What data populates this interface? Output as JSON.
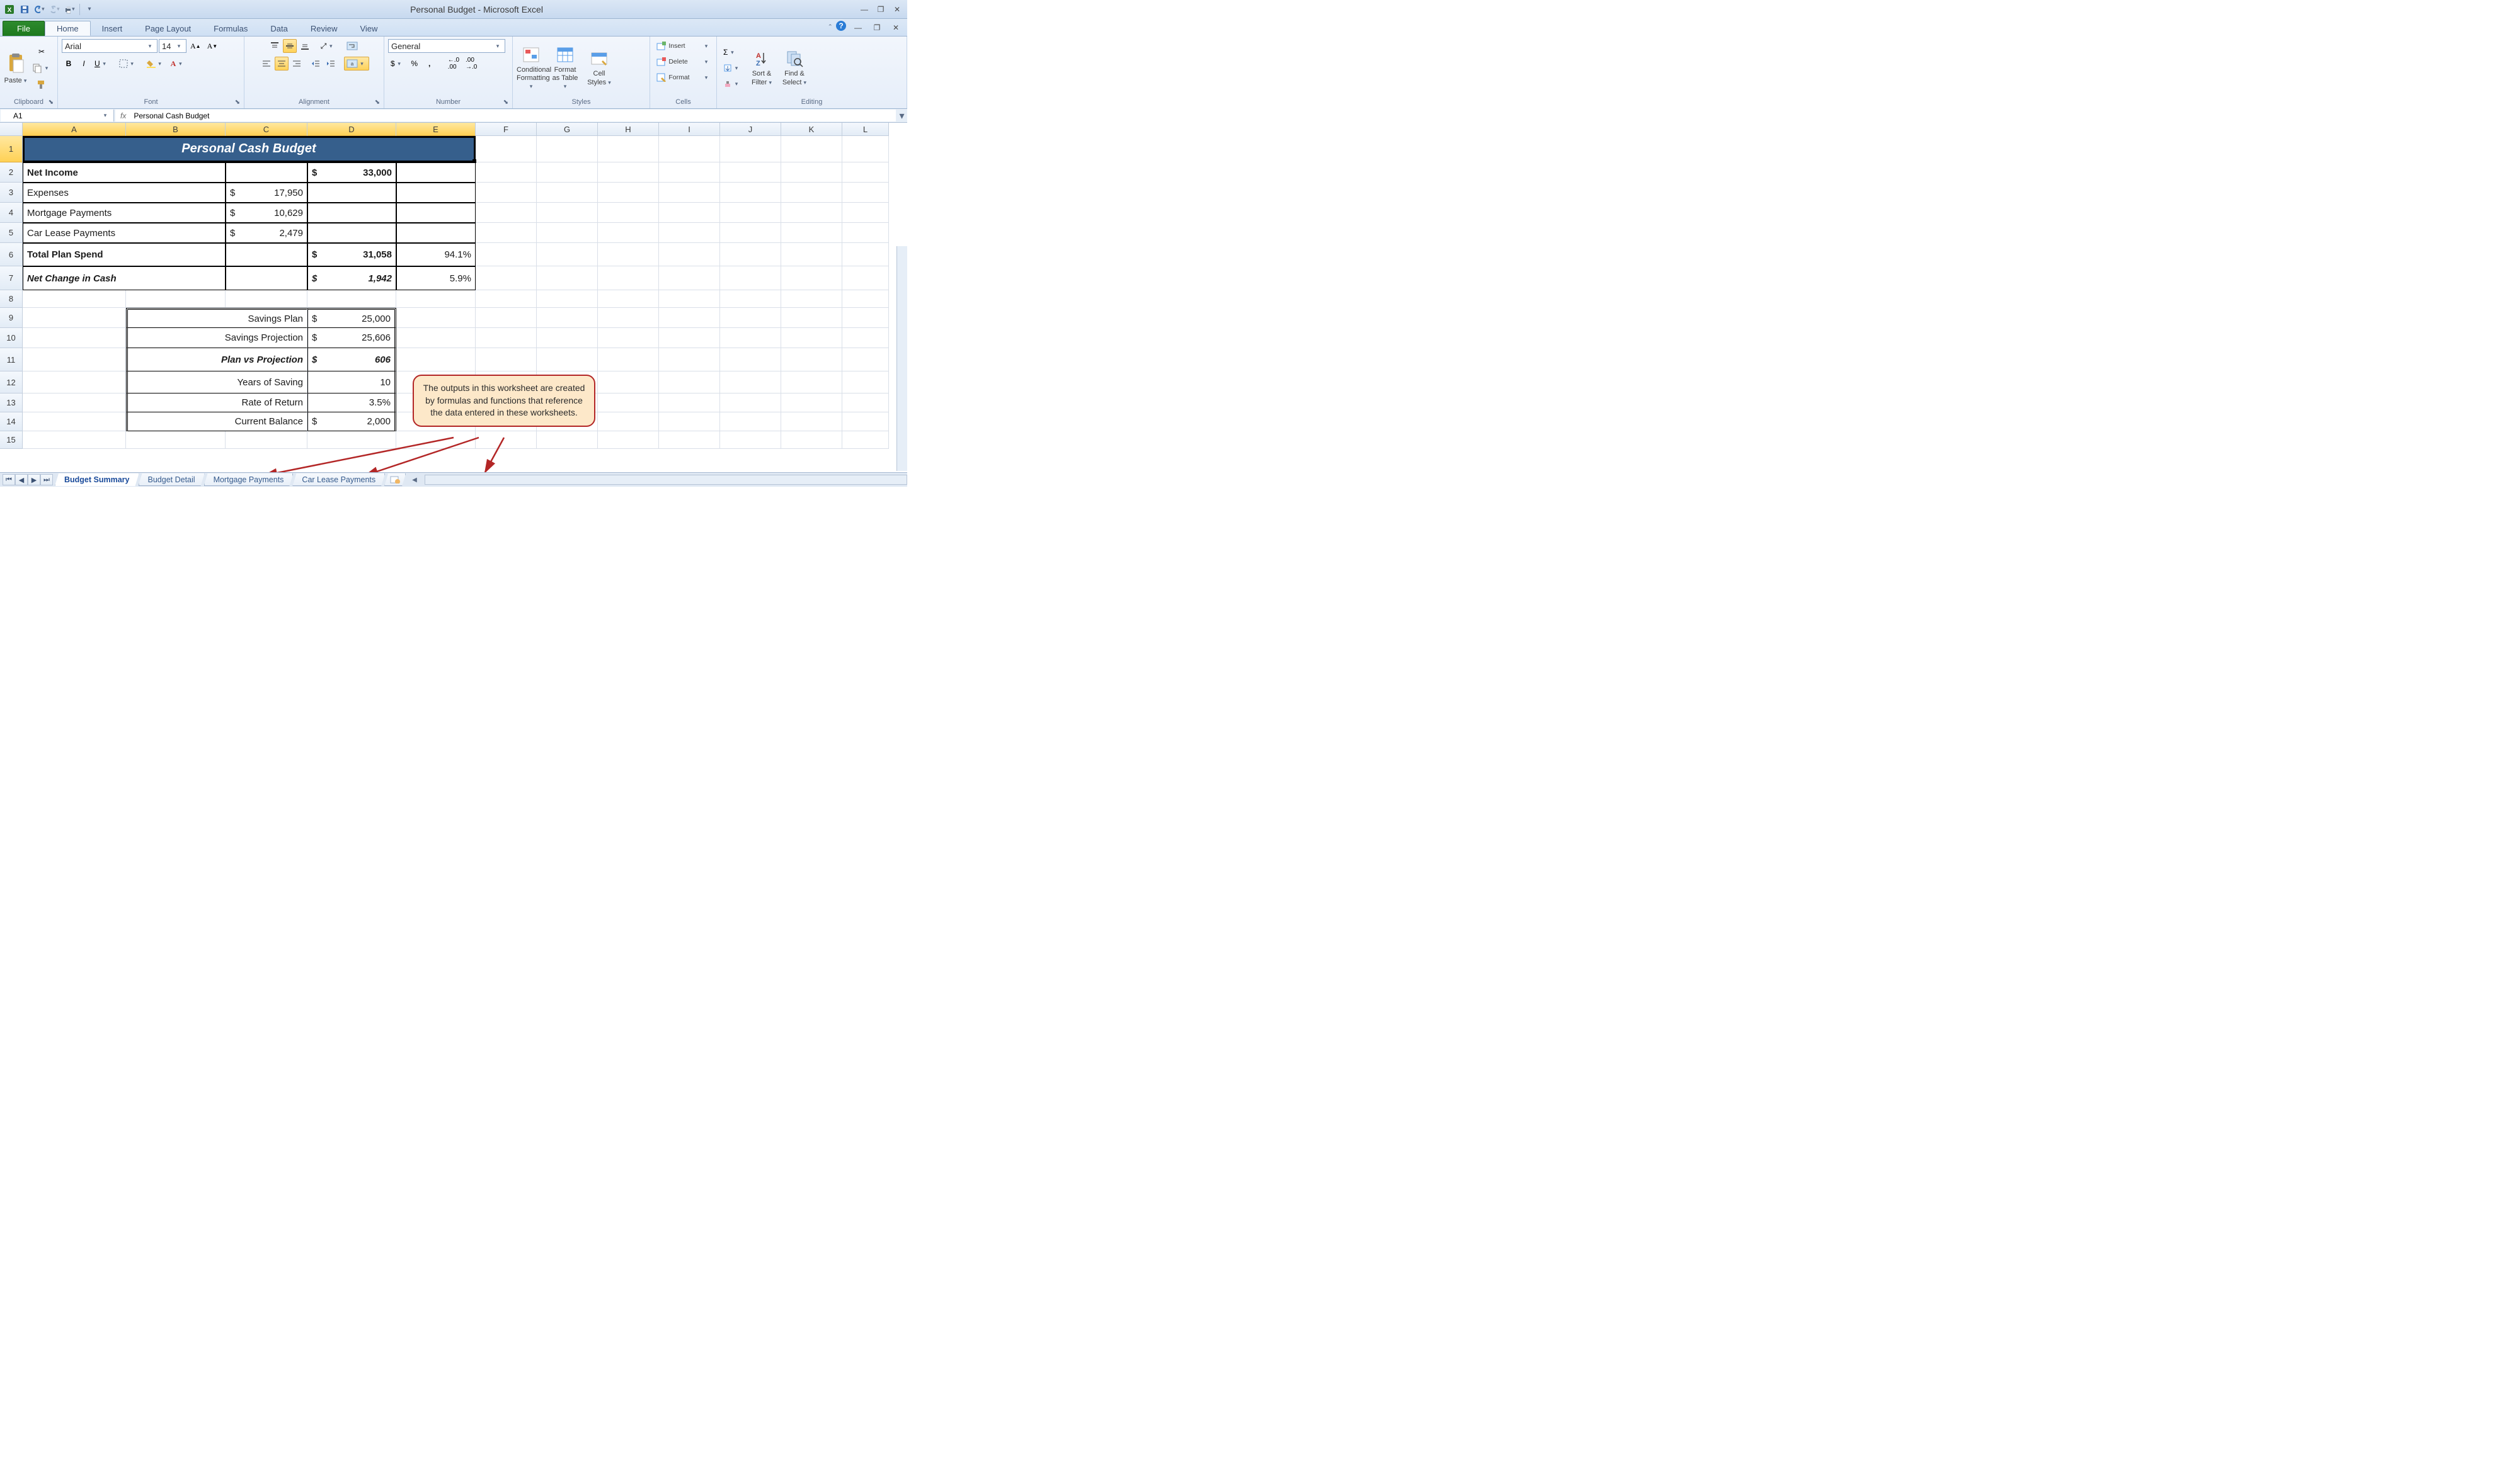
{
  "app_title": "Personal Budget - Microsoft Excel",
  "ribbon": {
    "file": "File",
    "tabs": [
      "Home",
      "Insert",
      "Page Layout",
      "Formulas",
      "Data",
      "Review",
      "View"
    ],
    "active_tab": "Home",
    "groups": {
      "clipboard": {
        "title": "Clipboard",
        "paste": "Paste"
      },
      "font": {
        "title": "Font",
        "name": "Arial",
        "size": "14"
      },
      "alignment": {
        "title": "Alignment"
      },
      "number": {
        "title": "Number",
        "format": "General"
      },
      "styles": {
        "title": "Styles",
        "cond": "Conditional Formatting",
        "fat": "Format as Table",
        "cell": "Cell Styles"
      },
      "cells": {
        "title": "Cells",
        "insert": "Insert",
        "delete": "Delete",
        "format": "Format"
      },
      "editing": {
        "title": "Editing",
        "sort": "Sort & Filter",
        "find": "Find & Select"
      }
    }
  },
  "name_box": "A1",
  "formula_bar": "Personal Cash Budget",
  "columns": [
    "A",
    "B",
    "C",
    "D",
    "E",
    "F",
    "G",
    "H",
    "I",
    "J",
    "K",
    "L"
  ],
  "col_widths": {
    "A": 164,
    "B": 158,
    "C": 130,
    "D": 141,
    "E": 126,
    "F": 97,
    "G": 97,
    "H": 97,
    "I": 97,
    "J": 97,
    "K": 97,
    "L": 74
  },
  "rows": [
    1,
    2,
    3,
    4,
    5,
    6,
    7,
    8,
    9,
    10,
    11,
    12,
    13,
    14,
    15
  ],
  "row_heights": {
    "1": 42,
    "2": 32,
    "3": 32,
    "4": 32,
    "5": 32,
    "6": 37,
    "7": 38,
    "8": 28,
    "9": 32,
    "10": 32,
    "11": 37,
    "12": 35,
    "13": 30,
    "14": 30,
    "15": 28
  },
  "budget": {
    "title": "Personal Cash Budget",
    "r2": {
      "label": "Net Income",
      "d_sym": "$",
      "d_val": "33,000"
    },
    "r3": {
      "label": "Expenses",
      "c_sym": "$",
      "c_val": "17,950"
    },
    "r4": {
      "label": "Mortgage Payments",
      "c_sym": "$",
      "c_val": "10,629"
    },
    "r5": {
      "label": "Car Lease Payments",
      "c_sym": "$",
      "c_val": "2,479"
    },
    "r6": {
      "label": "Total Plan Spend",
      "d_sym": "$",
      "d_val": "31,058",
      "e": "94.1%"
    },
    "r7": {
      "label": "Net Change in Cash",
      "d_sym": "$",
      "d_val": "1,942",
      "e": "5.9%"
    },
    "r9": {
      "label": "Savings Plan",
      "d_sym": "$",
      "d_val": "25,000"
    },
    "r10": {
      "label": "Savings Projection",
      "d_sym": "$",
      "d_val": "25,606"
    },
    "r11": {
      "label": "Plan vs Projection",
      "d_sym": "$",
      "d_val": "606"
    },
    "r12": {
      "label": "Years of Saving",
      "d_val": "10"
    },
    "r13": {
      "label": "Rate of Return",
      "d_val": "3.5%"
    },
    "r14": {
      "label": "Current Balance",
      "d_sym": "$",
      "d_val": "2,000"
    }
  },
  "callout": "The outputs in this worksheet are created by formulas and functions that reference the data entered in these worksheets.",
  "ws_tabs": [
    "Budget Summary",
    "Budget Detail",
    "Mortgage Payments",
    "Car Lease Payments"
  ],
  "chart_data": {
    "type": "table",
    "title": "Personal Cash Budget",
    "rows": [
      {
        "label": "Net Income",
        "amount": 33000
      },
      {
        "label": "Expenses",
        "amount": 17950
      },
      {
        "label": "Mortgage Payments",
        "amount": 10629
      },
      {
        "label": "Car Lease Payments",
        "amount": 2479
      },
      {
        "label": "Total Plan Spend",
        "amount": 31058,
        "pct": 94.1
      },
      {
        "label": "Net Change in Cash",
        "amount": 1942,
        "pct": 5.9
      },
      {
        "label": "Savings Plan",
        "amount": 25000
      },
      {
        "label": "Savings Projection",
        "amount": 25606
      },
      {
        "label": "Plan vs Projection",
        "amount": 606
      },
      {
        "label": "Years of Saving",
        "value": 10
      },
      {
        "label": "Rate of Return",
        "value": 0.035
      },
      {
        "label": "Current Balance",
        "amount": 2000
      }
    ]
  }
}
